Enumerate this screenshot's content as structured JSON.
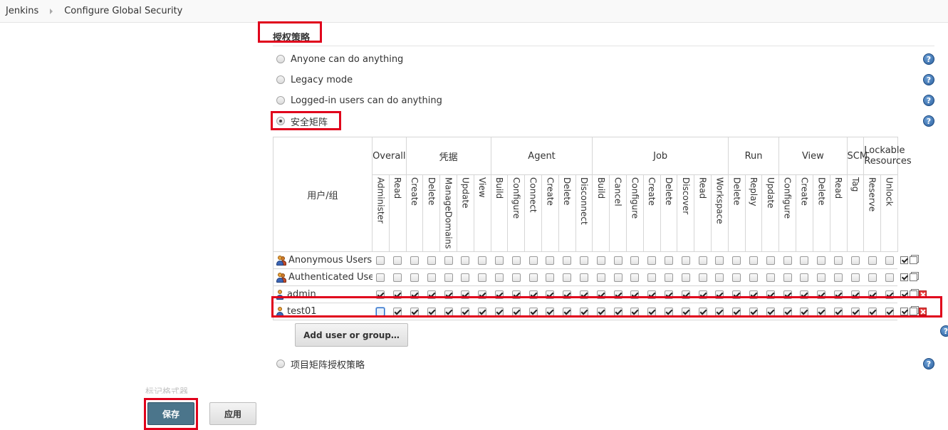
{
  "breadcrumb": {
    "items": [
      "Jenkins",
      "Configure Global Security"
    ]
  },
  "section": {
    "title": "授权策略"
  },
  "strategies": [
    {
      "label": "Anyone can do anything",
      "checked": false
    },
    {
      "label": "Legacy mode",
      "checked": false
    },
    {
      "label": "Logged-in users can do anything",
      "checked": false
    },
    {
      "label": "安全矩阵",
      "checked": true
    }
  ],
  "project_strategy": {
    "label": "项目矩阵授权策略",
    "checked": false
  },
  "matrix": {
    "user_group_header": "用户/组",
    "groups": [
      {
        "label": "Overall",
        "span": 2
      },
      {
        "label": "凭据",
        "span": 5
      },
      {
        "label": "Agent",
        "span": 6
      },
      {
        "label": "Job",
        "span": 8
      },
      {
        "label": "Run",
        "span": 3
      },
      {
        "label": "View",
        "span": 4
      },
      {
        "label": "SCM",
        "span": 1
      },
      {
        "label": "Lockable Resources",
        "span": 2
      }
    ],
    "permissions": [
      "Administer",
      "Read",
      "Create",
      "Delete",
      "ManageDomains",
      "Update",
      "View",
      "Build",
      "Configure",
      "Connect",
      "Create",
      "Delete",
      "Disconnect",
      "Build",
      "Cancel",
      "Configure",
      "Create",
      "Delete",
      "Discover",
      "Read",
      "Workspace",
      "Delete",
      "Replay",
      "Update",
      "Configure",
      "Create",
      "Delete",
      "Read",
      "Tag",
      "Reserve",
      "Unlock"
    ],
    "rows": [
      {
        "name": "Anonymous Users",
        "icon": "group-icon",
        "deletable": false,
        "all_checked": false,
        "first_unchecked_focus": false
      },
      {
        "name": "Authenticated Users",
        "icon": "group-icon",
        "deletable": false,
        "all_checked": false,
        "first_unchecked_focus": false
      },
      {
        "name": "admin",
        "icon": "user-icon",
        "deletable": true,
        "all_checked": true,
        "first_unchecked_focus": false
      },
      {
        "name": "test01",
        "icon": "user-icon",
        "deletable": true,
        "all_checked": true,
        "first_unchecked_focus": true
      }
    ]
  },
  "buttons": {
    "add_user": "Add user or group…",
    "save": "保存",
    "apply": "应用"
  },
  "faded_label": "标记格式器",
  "icons": {
    "help": "?"
  },
  "colors": {
    "highlight": "#e0001b",
    "primary_button": "#4b758b"
  }
}
